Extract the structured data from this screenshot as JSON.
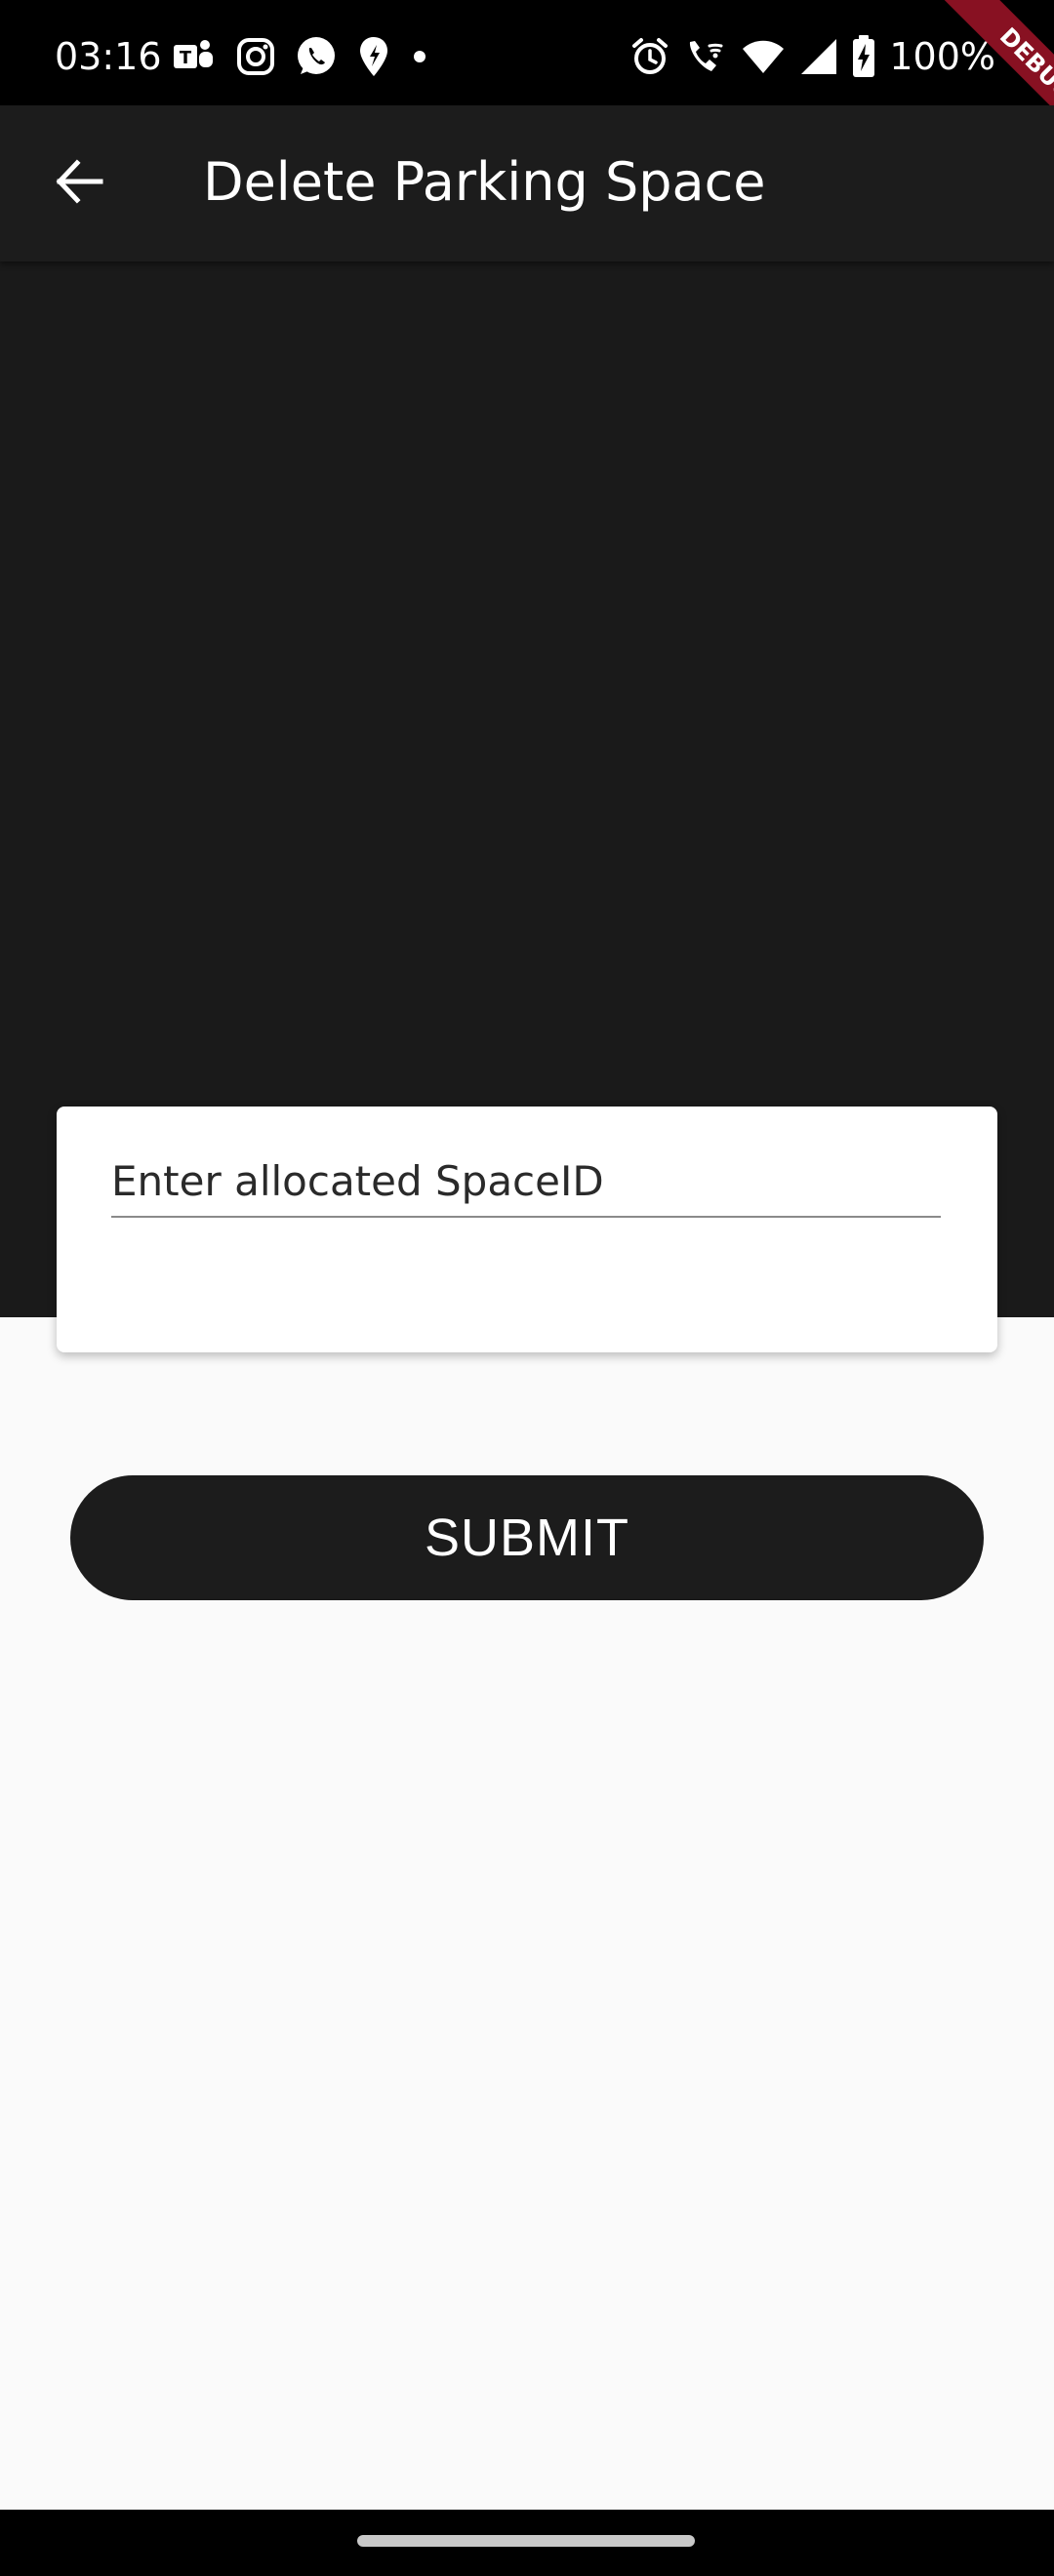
{
  "status_bar": {
    "time": "03:16",
    "battery_text": "100%",
    "left_icons": [
      "teams-icon",
      "instagram-icon",
      "whatsapp-icon",
      "maps-icon",
      "dot-icon"
    ],
    "right_icons": [
      "alarm-icon",
      "wifi-calling-icon",
      "wifi-icon",
      "signal-icon",
      "battery-charging-icon"
    ]
  },
  "debug_banner": {
    "label": "DEBUG"
  },
  "app_bar": {
    "title": "Delete Parking Space",
    "back_icon": "arrow-back-icon"
  },
  "form": {
    "space_id_placeholder": "Enter allocated SpaceID",
    "space_id_value": ""
  },
  "submit": {
    "label": "SUBMIT"
  },
  "colors": {
    "status_bar": "#000000",
    "app_bar": "#1c1c1c",
    "hero": "#1a1a1a",
    "page_background": "#fafafa",
    "card": "#ffffff",
    "button": "#1c1c1c",
    "button_text": "#ffffff",
    "debug_banner": "#a01428"
  }
}
